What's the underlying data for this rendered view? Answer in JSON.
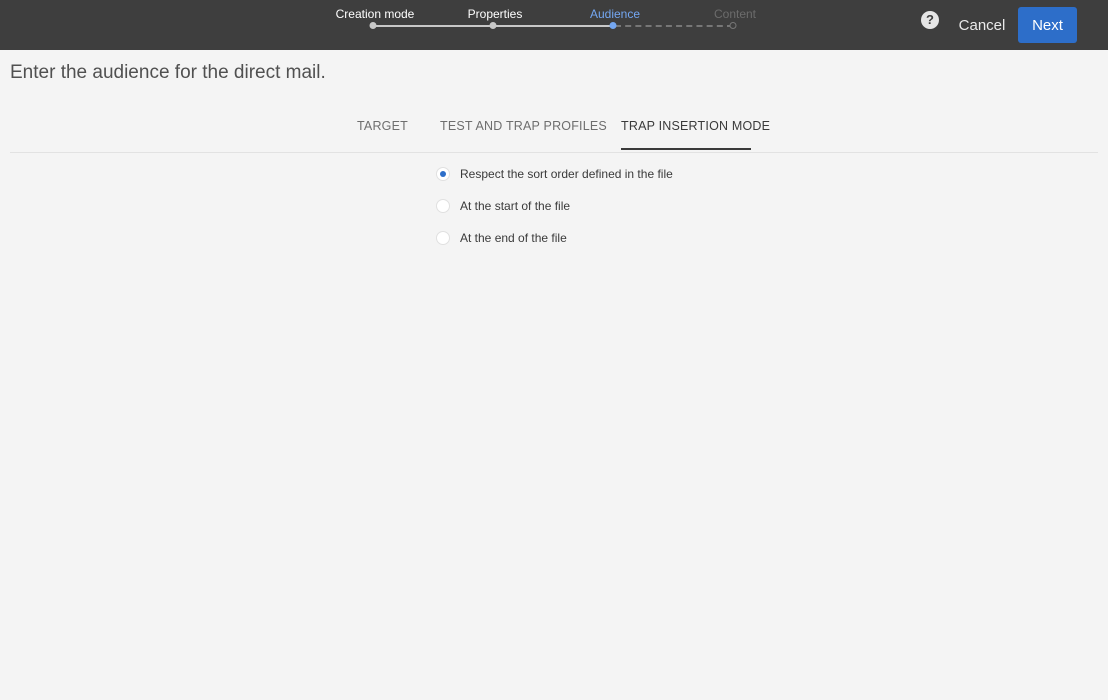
{
  "stepper": {
    "steps": [
      {
        "label": "Creation mode",
        "state": "done"
      },
      {
        "label": "Properties",
        "state": "done"
      },
      {
        "label": "Audience",
        "state": "active"
      },
      {
        "label": "Content",
        "state": "future"
      }
    ]
  },
  "header": {
    "help_icon": "question-mark",
    "help_glyph": "?",
    "cancel_label": "Cancel",
    "next_label": "Next",
    "accent_color": "#2d6ec9"
  },
  "page": {
    "title": "Enter the audience for the direct mail."
  },
  "tabs": [
    {
      "label": "TARGET",
      "active": false
    },
    {
      "label": "TEST AND TRAP PROFILES",
      "active": false
    },
    {
      "label": "TRAP INSERTION MODE",
      "active": true
    }
  ],
  "trap_insertion": {
    "options": [
      {
        "label": "Respect the sort order defined in the file",
        "selected": true
      },
      {
        "label": "At the start of the file",
        "selected": false
      },
      {
        "label": "At the end of the file",
        "selected": false
      }
    ]
  }
}
